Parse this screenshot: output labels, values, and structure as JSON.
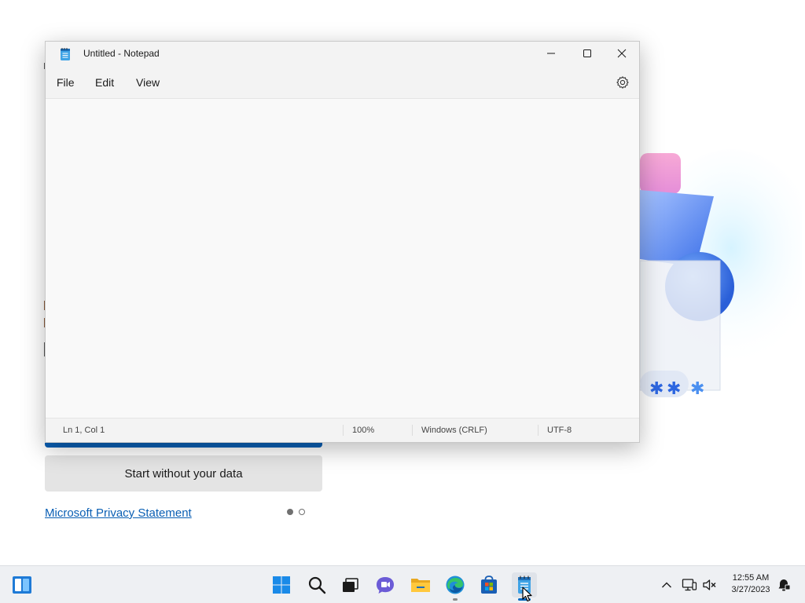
{
  "notepad": {
    "title": "Untitled - Notepad",
    "menu": {
      "file": "File",
      "edit": "Edit",
      "view": "View"
    },
    "editor_value": "",
    "status": {
      "position": "Ln 1, Col 1",
      "zoom": "100%",
      "line_ending": "Windows (CRLF)",
      "encoding": "UTF-8"
    }
  },
  "background_page": {
    "secondary_button": "Start without your data",
    "privacy_link": "Microsoft Privacy Statement",
    "pager": {
      "count": 2,
      "active_index": 0
    }
  },
  "taskbar": {
    "apps": [
      "widgets-icon",
      "start-icon",
      "search-icon",
      "task-view-icon",
      "chat-icon",
      "file-explorer-icon",
      "edge-icon",
      "store-icon",
      "notepad-icon"
    ],
    "clock_time": "12:55 AM",
    "clock_date": "3/27/2023"
  },
  "colors": {
    "accent": "#0067c0",
    "link": "#0a5fb4",
    "window_bg": "#f9f9f9"
  }
}
